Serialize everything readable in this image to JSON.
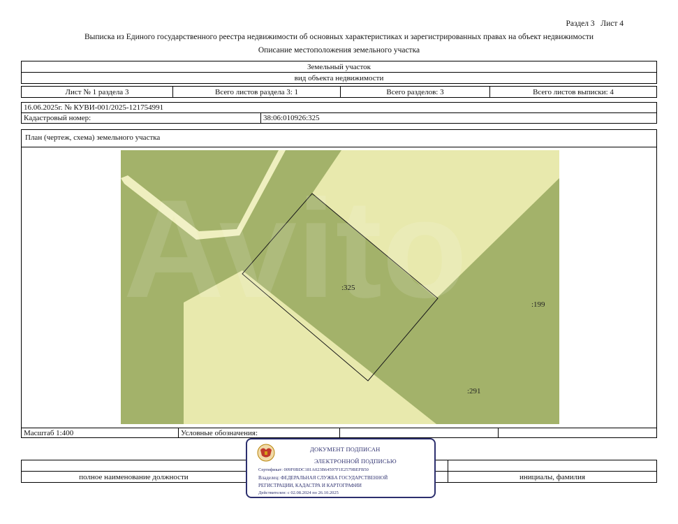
{
  "header": {
    "section_sheet": "Раздел 3   Лист 4",
    "title": "Выписка из Единого государственного реестра недвижимости об основных характеристиках и зарегистрированных правах на объект недвижимости",
    "subtitle": "Описание местоположения земельного участка"
  },
  "object": {
    "type": "Земельный участок",
    "type_caption": "вид объекта недвижимости"
  },
  "sheets": {
    "sheet": "Лист № 1 раздела 3",
    "total_sheets_section": "Всего листов раздела 3: 1",
    "total_sections": "Всего разделов: 3",
    "total_sheets_extract": "Всего листов выписки: 4"
  },
  "record": {
    "date_number": "16.06.2025г. № КУВИ-001/2025-121754991",
    "cadastral_label": "Кадастровый номер:",
    "cadastral_number": "38:06:010926:325"
  },
  "plan": {
    "title": "План (чертеж, схема) земельного участка",
    "parcel_labels": {
      "main": ":325",
      "east": ":199",
      "south": ":291"
    },
    "watermark": "Avito",
    "colors": {
      "green": "#a3b26a",
      "yellow": "#e8e9ad",
      "road": "#efefbf"
    }
  },
  "footer": {
    "scale": "Масштаб 1:400",
    "legend": "Условные обозначения:",
    "position_caption": "полное наименование должности",
    "name_caption": "инициалы, фамилия"
  },
  "stamp": {
    "line1": "ДОКУМЕНТ ПОДПИСАН",
    "line2": "ЭЛЕКТРОННОЙ ПОДПИСЬЮ",
    "certificate": "Сертификат: 009F0BDC181A023B64597F1E2579BEFB50",
    "owner1": "Владелец: ФЕДЕРАЛЬНАЯ СЛУЖБА ГОСУДАРСТВЕННОЙ",
    "owner2": "РЕГИСТРАЦИИ, КАДАСТРА И КАРТОГРАФИИ",
    "validity": "Действителен: с 02.08.2024 по 26.10.2025"
  }
}
